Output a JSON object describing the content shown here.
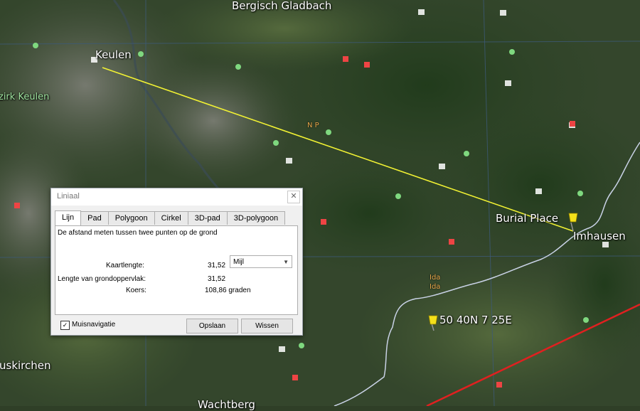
{
  "map": {
    "labels": {
      "bergisch_gladbach": "Bergisch Gladbach",
      "keulen": "Keulen",
      "zirk_keulen": "zirk Keulen",
      "np": "N P",
      "burial_place": "Burial Place",
      "imhausen": "Imhausen",
      "ida1": "Ida",
      "ida2": "Ida",
      "coordinate": "50 40N  7 25E",
      "euskirchen": "uskirchen",
      "wachtberg": "Wachtberg"
    },
    "colors": {
      "ruler_line": "#f2f233",
      "red_line": "#e02020",
      "border_line": "#c9d2e6",
      "grid_line": "#3d5a78",
      "pin": "#f4e01a"
    }
  },
  "ruler": {
    "title": "Liniaal",
    "close_glyph": "✕",
    "tabs": [
      "Lijn",
      "Pad",
      "Polygoon",
      "Cirkel",
      "3D-pad",
      "3D-polygoon"
    ],
    "active_tab": "Lijn",
    "description": "De afstand meten tussen twee punten op de grond",
    "map_length_label": "Kaartlengte:",
    "map_length_value": "31,52",
    "unit": "Mijl",
    "ground_length_label": "Lengte van grondoppervlak:",
    "ground_length_value": "31,52",
    "heading_label": "Koers:",
    "heading_value": "108,86 graden",
    "mouse_nav_label": "Muisnavigatie",
    "mouse_nav_checked": "✓",
    "save_label": "Opslaan",
    "clear_label": "Wissen"
  }
}
